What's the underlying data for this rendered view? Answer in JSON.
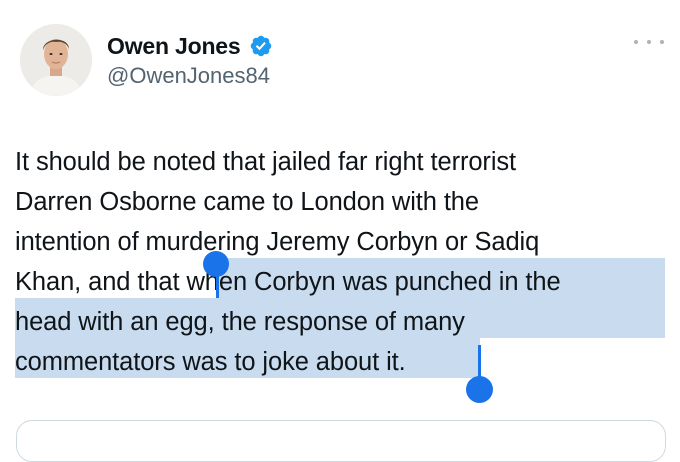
{
  "author": {
    "name": "Owen Jones",
    "handle": "@OwenJones84",
    "verified_color": "#1d9bf0"
  },
  "icons": {
    "more": "more-horizontal-icon",
    "verified": "verified-badge-icon"
  },
  "tweet": {
    "lines": [
      "It should be noted that jailed far right terrorist",
      "Darren Osborne came to London with the",
      "intention of murdering Jeremy Corbyn or Sadiq",
      "Khan, and that when Corbyn was punched in the",
      "head with an egg, the response of many",
      "commentators was to joke about it."
    ]
  },
  "selection": {
    "color": "#c9dcef",
    "handle_color": "#1a73e8"
  }
}
